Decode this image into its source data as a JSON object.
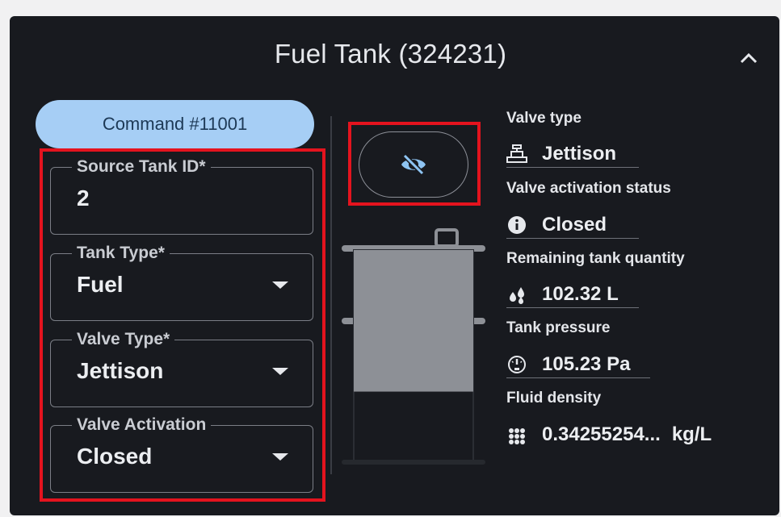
{
  "panel": {
    "title": "Fuel Tank (324231)",
    "command_label": "Command #11001"
  },
  "form": {
    "source_tank": {
      "label": "Source Tank ID*",
      "value": "2"
    },
    "tank_type": {
      "label": "Tank Type*",
      "value": "Fuel"
    },
    "valve_type": {
      "label": "Valve Type*",
      "value": "Jettison"
    },
    "valve_activation": {
      "label": "Valve Activation",
      "value": "Closed"
    }
  },
  "tank_visual": {
    "fill_fraction": 0.67,
    "fill_color": "#8d9096"
  },
  "info": {
    "valve_type": {
      "label": "Valve type",
      "value": "Jettison",
      "icon": "valve-icon"
    },
    "valve_status": {
      "label": "Valve activation status",
      "value": "Closed",
      "icon": "info-icon"
    },
    "remaining": {
      "label": "Remaining tank quantity",
      "value": "102.32 L",
      "icon": "droplets-icon"
    },
    "pressure": {
      "label": "Tank pressure",
      "value": "105.23 Pa",
      "icon": "gauge-icon"
    },
    "density": {
      "label": "Fluid density",
      "value": "0.34255254...",
      "unit": "kg/L",
      "icon": "density-icon"
    }
  },
  "colors": {
    "panel_bg": "#181a1f",
    "accent": "#a6cef5",
    "highlight": "#e4131e",
    "visibility_icon": "#8ec4f2"
  }
}
